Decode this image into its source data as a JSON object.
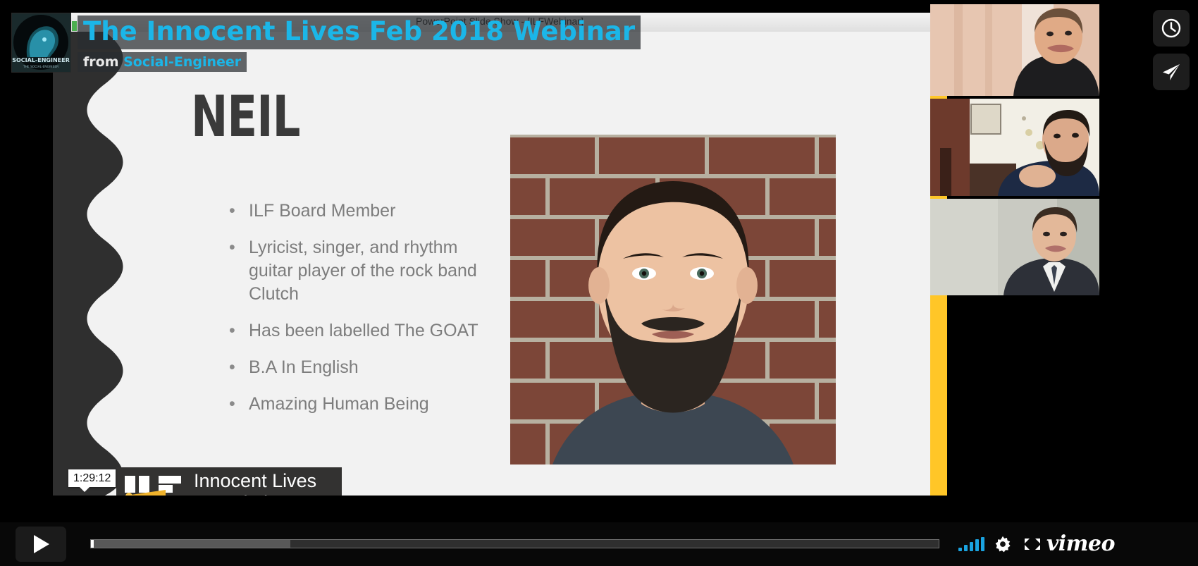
{
  "player": {
    "provider": "vimeo",
    "logo_text": "vimeo",
    "title": "The Innocent Lives Feb 2018 Webinar",
    "from_label": "from",
    "channel": "Social-Engineer",
    "time_tooltip": "1:29:12",
    "accent_color": "#1bb6e8",
    "controls": {
      "play_label": "Play",
      "watch_later_label": "Watch Later",
      "share_label": "Share",
      "volume_label": "Volume",
      "settings_label": "Settings",
      "fullscreen_label": "Fullscreen",
      "progress_played_percent": 0.35,
      "progress_loaded_percent": 23.5
    },
    "icons": {
      "play": "play-icon",
      "watch_later": "clock-icon",
      "share": "paper-plane-icon",
      "volume": "volume-bars-icon",
      "settings": "gear-icon",
      "fullscreen": "fullscreen-icon",
      "avatar": "social-engineer-avatar"
    }
  },
  "shared_screen": {
    "window_title": "PowerPoint Slide Show - [ILFWebinar]",
    "slide": {
      "heading": "NEIL",
      "bullet_marker": "•",
      "bullets": [
        "ILF Board Member",
        "Lyricist, singer, and rhythm guitar player of the rock band Clutch",
        "Has been labelled The GOAT",
        "B.A In English",
        "Amazing Human Being"
      ],
      "portrait_alt": "Portrait of bearded man in front of brick wall",
      "footer_logo": {
        "line1": "Innocent Lives",
        "line2": "Foundation"
      },
      "accent_bar_color": "#ffc627",
      "background_color": "#f2f2f2",
      "dark_color": "#2f2f2f"
    }
  },
  "participants": [
    {
      "name": "participant-1",
      "alt": "Man in dark shirt in front of beige curtain"
    },
    {
      "name": "participant-2",
      "alt": "Bearded man in dark sweater in home office"
    },
    {
      "name": "participant-3",
      "alt": "Man in suit against pale wall"
    }
  ]
}
